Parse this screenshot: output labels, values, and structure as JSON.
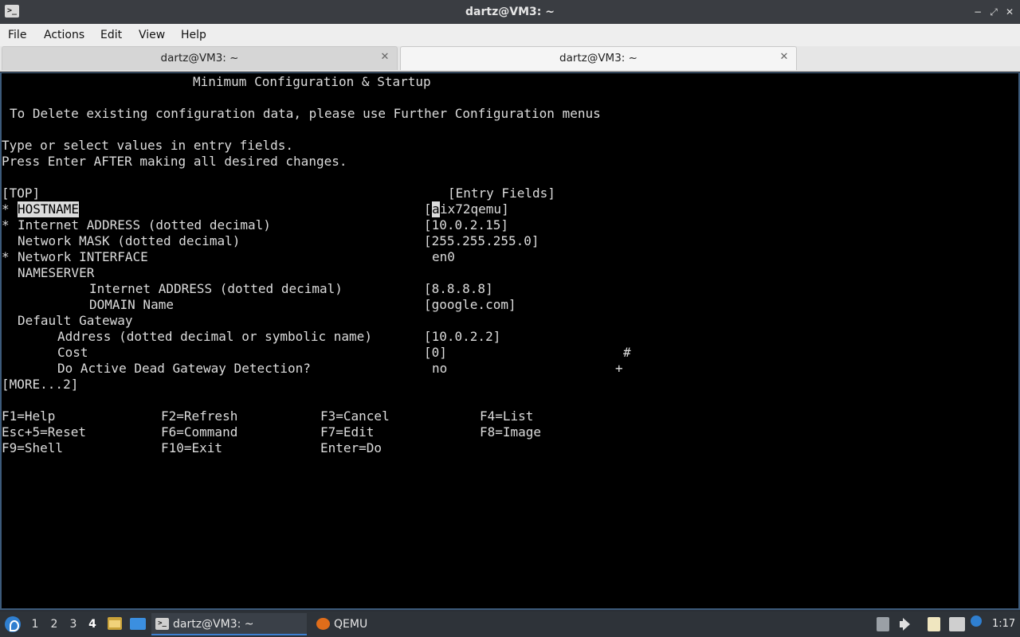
{
  "window": {
    "title": "dartz@VM3: ~",
    "app_icon": "terminal-icon",
    "buttons": [
      "minimize-icon",
      "maximize-icon",
      "close-icon"
    ]
  },
  "menu": {
    "file": "File",
    "actions": "Actions",
    "edit": "Edit",
    "view": "View",
    "help": "Help"
  },
  "tabs": [
    {
      "label": "dartz@VM3: ~",
      "active": false
    },
    {
      "label": "dartz@VM3: ~",
      "active": true
    }
  ],
  "screen": {
    "heading": "Minimum Configuration & Startup",
    "notice": "To Delete existing configuration data, please use Further Configuration menus",
    "instr1": "Type or select values in entry fields.",
    "instr2": "Press Enter AFTER making all desired changes.",
    "top_marker": "[TOP]",
    "entry_header": "[Entry Fields]",
    "more": "[MORE...2]",
    "fields": [
      {
        "star": "*",
        "label": "HOSTNAME",
        "value_cursor": "a",
        "value_rest": "ix72qemu]",
        "open_bracket": "["
      },
      {
        "star": "*",
        "label": "Internet ADDRESS (dotted decimal)",
        "value": "[10.0.2.15]"
      },
      {
        "label": "Network MASK (dotted decimal)",
        "value": "[255.255.255.0]"
      },
      {
        "star": "*",
        "label": "Network INTERFACE",
        "value": "en0"
      },
      {
        "label": "NAMESERVER"
      },
      {
        "label": "Internet ADDRESS (dotted decimal)",
        "value": "[8.8.8.8]"
      },
      {
        "label": "DOMAIN Name",
        "value": "[google.com]"
      },
      {
        "label": "Default Gateway"
      },
      {
        "label": "Address (dotted decimal or symbolic name)",
        "value": "[10.0.2.2]"
      },
      {
        "label": "Cost",
        "value": "[0]",
        "flag": "#"
      },
      {
        "label": "Do Active Dead Gateway Detection?",
        "value": "no",
        "flag": "+"
      }
    ],
    "fkeys": [
      [
        "F1=Help",
        "F2=Refresh",
        "F3=Cancel",
        "F4=List"
      ],
      [
        "Esc+5=Reset",
        "F6=Command",
        "F7=Edit",
        "F8=Image"
      ],
      [
        "F9=Shell",
        "F10=Exit",
        "Enter=Do"
      ]
    ]
  },
  "taskbar": {
    "workspaces": [
      "1",
      "2",
      "3",
      "4"
    ],
    "current_workspace": "4",
    "tasks": [
      {
        "label": "dartz@VM3: ~",
        "icon": "terminal-icon",
        "active": true
      },
      {
        "label": "QEMU",
        "icon": "qemu-icon",
        "active": false
      }
    ],
    "tray_icons": [
      "storage-icon",
      "volume-icon",
      "clipboard-icon",
      "display-icon",
      "update-notifier-icon"
    ],
    "clock": "1:17"
  }
}
